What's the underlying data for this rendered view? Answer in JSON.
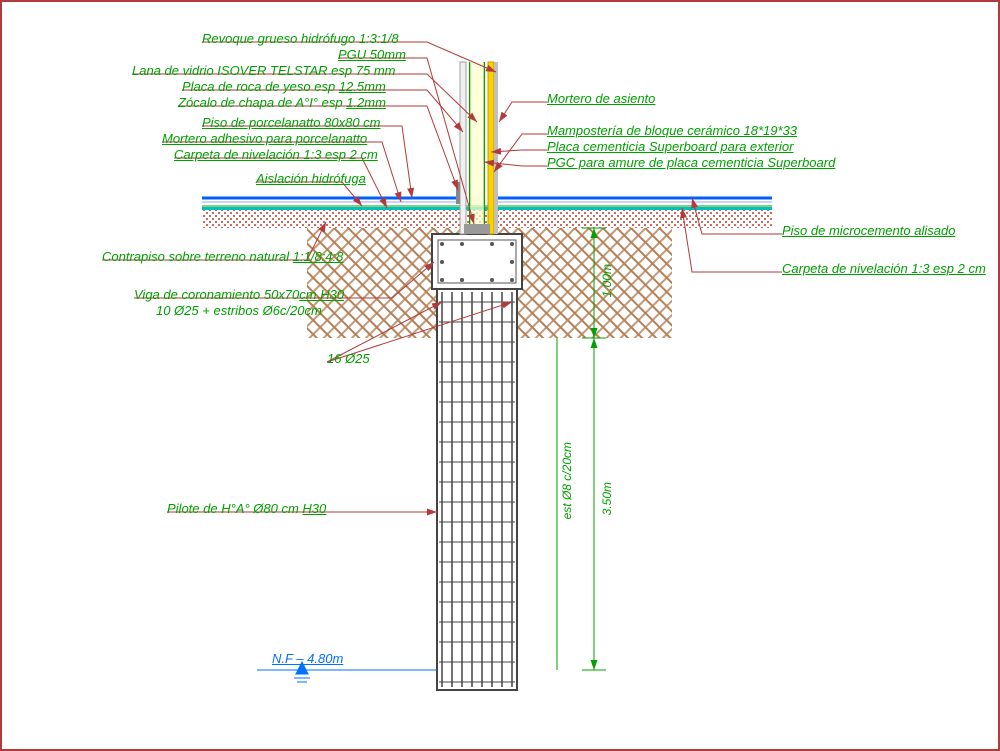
{
  "labels_left": {
    "revoque": "Revoque grueso hidrófugo 1:3:1/8",
    "pgu": "PGU 50mm",
    "lana": "Lana de vidrio ISOVER TELSTAR esp 75 mm",
    "placa_yeso": "Placa de roca de yeso esp 12.5mm",
    "zocalo": "Zócalo de chapa de A°I° esp 1.2mm",
    "piso_porc": "Piso de porcelanatto 80x80 cm",
    "mortero_adh": "Mortero adhesivo para porcelanatto",
    "carpeta": "Carpeta de nivelación 1:3 esp 2 cm",
    "aislacion": "Aislación hidrófuga",
    "contrapiso": "Contrapiso sobre terreno natural 1:1/8:4:8",
    "viga1": "Viga de coronamiento 50x70cm H30",
    "viga2": "10 Ø25 + estribos Ø6c/20cm",
    "rebar16": "16 Ø25",
    "pilote": "Pilote de H°A° Ø80 cm H30",
    "nf": "N.F – 4.80m"
  },
  "labels_right": {
    "mortero_as": "Mortero de asiento",
    "mamp": "Mampostería de bloque cerámico 18*19*33",
    "placa_cem": "Placa cementicia Superboard para exterior",
    "pgc": "PGC para amure de placa cementicia Superboard",
    "piso_micro": "Piso de microcemento alisado",
    "carpeta_d": "Carpeta de nivelación 1:3 esp 2 cm"
  },
  "dims": {
    "h_top": "1.00m",
    "h_pile": "3.50m",
    "estribo": "est Ø8 c/20cm"
  },
  "elements": {
    "pile_rebar_count": 8,
    "beam": {
      "w": 90,
      "h": 55
    },
    "floor_thickness": 18,
    "gravel_band": 16,
    "wall_width": 36,
    "foundation_fill_h": 100
  }
}
